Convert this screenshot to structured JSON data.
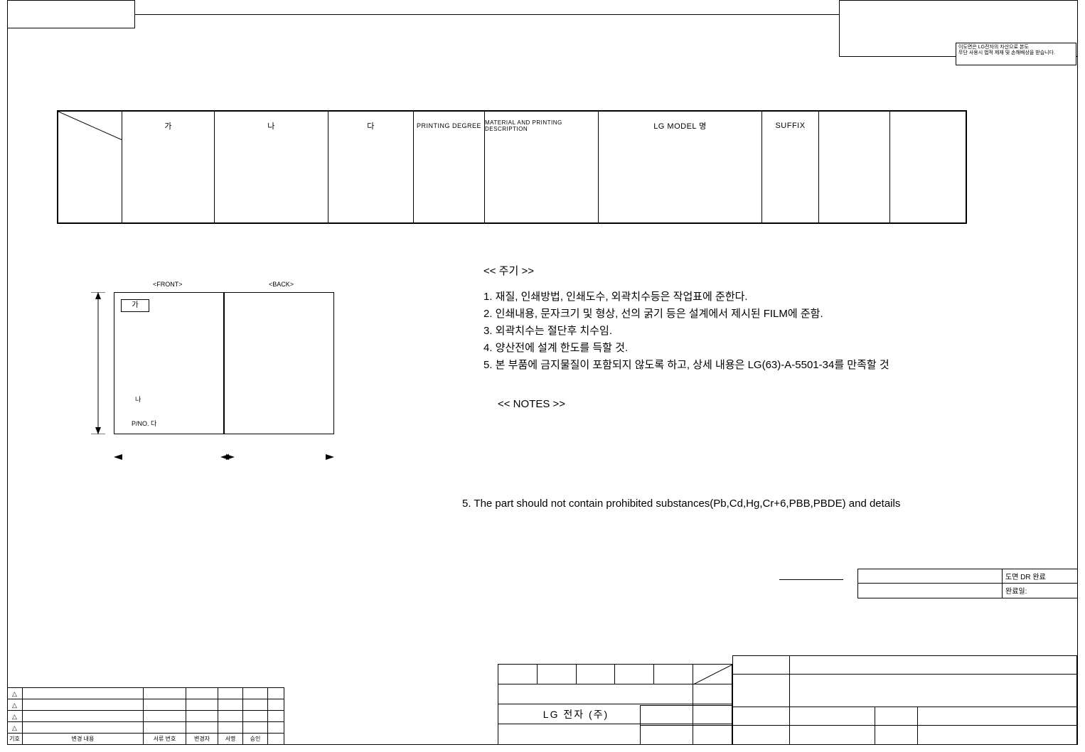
{
  "confidential": {
    "line1": "이도면은 LG전자의 자산으로 본도",
    "line2": "무단 사용시 법적 제재 및 손해배상을 받습니다."
  },
  "mainTable": {
    "headers": {
      "ga": "가",
      "na": "나",
      "da": "다",
      "printing": "PRINTING DEGREE",
      "material": "MATERIAL AND PRINTING DESCRIPTION",
      "model": "LG MODEL 명",
      "suffix": "SUFFIX"
    }
  },
  "diagram": {
    "front": "<FRONT>",
    "back": "<BACK>",
    "ga": "가",
    "na": "나",
    "pno": "P/NO. 다"
  },
  "notesHead": "<< 주기 >>",
  "notes": [
    "1. 재질, 인쇄방법, 인쇄도수, 외곽치수등은 작업표에 준한다.",
    "2. 인쇄내용, 문자크기 및 형상, 선의 굵기 등은 설계에서 제시된 FILM에 준함.",
    "3. 외곽치수는 절단후 치수임.",
    "4. 양산전에 설계 한도를 득할 것.",
    "5. 본 부품에 금지물질이 포함되지 않도록 하고, 상세 내용은 LG(63)-A-5501-34를 만족할 것"
  ],
  "notes2Head": "<< NOTES >>",
  "note5en": "5. The part should not contain prohibited substances(Pb,Cd,Hg,Cr+6,PBB,PBDE) and details",
  "drBox": {
    "row1": "도면 DR 완료",
    "row2": "완료일:"
  },
  "company": "LG 전자    (주)",
  "revHeaders": {
    "mark": "기호",
    "desc": "변경 내용",
    "dateno": "서류 번호",
    "date": "변경자",
    "by": "서명",
    "appr": "승인"
  },
  "triangle": "△"
}
